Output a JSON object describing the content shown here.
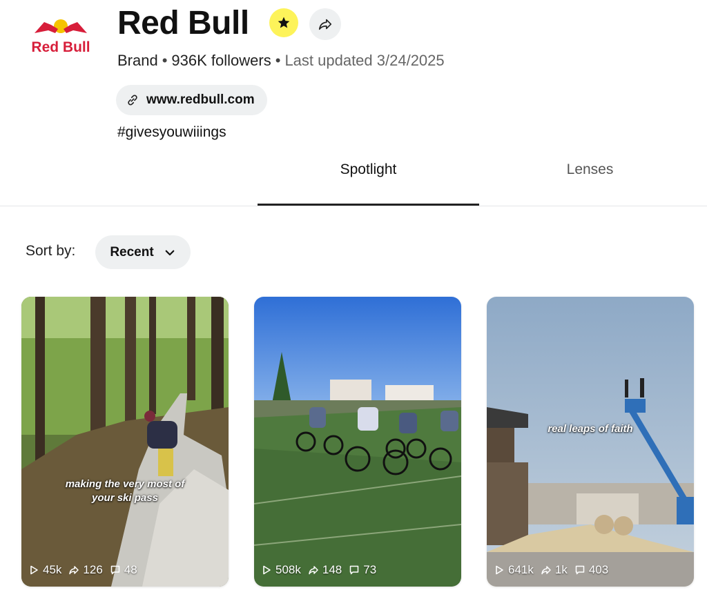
{
  "profile": {
    "logo_text": "Red Bull",
    "name": "Red Bull",
    "category": "Brand",
    "followers": "936K followers",
    "updated": "Last updated 3/24/2025",
    "website": "www.redbull.com",
    "bio": "#givesyouwiiings"
  },
  "tabs": [
    {
      "label": "Spotlight",
      "active": true
    },
    {
      "label": "Lenses",
      "active": false
    }
  ],
  "sort": {
    "label": "Sort by:",
    "value": "Recent"
  },
  "cards": [
    {
      "caption_line1": "making the very most of",
      "caption_line2": "your ski pass",
      "views": "45k",
      "shares": "126",
      "comments": "48"
    },
    {
      "caption_line1": "",
      "caption_line2": "",
      "views": "508k",
      "shares": "148",
      "comments": "73"
    },
    {
      "caption_line1": "real leaps of faith",
      "caption_line2": "",
      "views": "641k",
      "shares": "1k",
      "comments": "403"
    }
  ],
  "colors": {
    "brand_red": "#d71e3a",
    "brand_yellow": "#f5c400",
    "badge_yellow": "#fdf35a",
    "pill_bg": "#eef0f1"
  },
  "icons": [
    "red-bull-logo",
    "star-icon",
    "share-icon",
    "link-icon",
    "chevron-down-icon",
    "play-icon",
    "share-arrow-icon",
    "comment-icon"
  ]
}
